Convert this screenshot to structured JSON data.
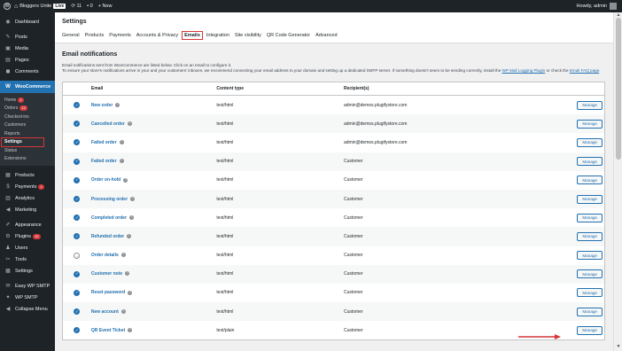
{
  "adminbar": {
    "site_name": "Bloggers Unite",
    "live_badge": "Live",
    "updates_count": "11",
    "comments_count": "0",
    "new_label": "New",
    "greeting": "Howdy, admin"
  },
  "sidebar": {
    "items_top": [
      {
        "icon": "dashboard-icon",
        "glyph": "◉",
        "label": "Dashboard"
      },
      {
        "icon": "pin-icon",
        "glyph": "✎",
        "label": "Posts"
      },
      {
        "icon": "media-icon",
        "glyph": "▣",
        "label": "Media"
      },
      {
        "icon": "pages-icon",
        "glyph": "▤",
        "label": "Pages"
      },
      {
        "icon": "comments-icon",
        "glyph": "◼",
        "label": "Comments"
      }
    ],
    "woocommerce": {
      "icon": "woocommerce-icon",
      "glyph": "W",
      "label": "WooCommerce"
    },
    "submenu": [
      {
        "label": "Home",
        "badge": "2"
      },
      {
        "label": "Orders",
        "badge": "13"
      },
      {
        "label": "Checked-ins",
        "badge": ""
      },
      {
        "label": "Customers",
        "badge": ""
      },
      {
        "label": "Reports",
        "badge": ""
      },
      {
        "label": "Settings",
        "badge": ""
      },
      {
        "label": "Status",
        "badge": ""
      },
      {
        "label": "Extensions",
        "badge": ""
      }
    ],
    "items_bottom": [
      {
        "icon": "products-icon",
        "glyph": "▦",
        "label": "Products",
        "badge": ""
      },
      {
        "icon": "payments-icon",
        "glyph": "$",
        "label": "Payments",
        "badge": "1"
      },
      {
        "icon": "analytics-icon",
        "glyph": "▥",
        "label": "Analytics",
        "badge": ""
      },
      {
        "icon": "marketing-icon",
        "glyph": "◀",
        "label": "Marketing",
        "badge": ""
      },
      {
        "icon": "appearance-icon",
        "glyph": "✐",
        "label": "Appearance",
        "badge": ""
      },
      {
        "icon": "plugins-icon",
        "glyph": "⚙",
        "label": "Plugins",
        "badge": "10"
      },
      {
        "icon": "users-icon",
        "glyph": "♟",
        "label": "Users",
        "badge": ""
      },
      {
        "icon": "tools-icon",
        "glyph": "✂",
        "label": "Tools",
        "badge": ""
      },
      {
        "icon": "settings-icon",
        "glyph": "▩",
        "label": "Settings",
        "badge": ""
      },
      {
        "icon": "easy-wp-smtp-icon",
        "glyph": "✉",
        "label": "Easy WP SMTP",
        "badge": ""
      },
      {
        "icon": "wp-smtp-icon",
        "glyph": "✦",
        "label": "WP SMTP",
        "badge": ""
      },
      {
        "icon": "collapse-menu-icon",
        "glyph": "◀",
        "label": "Collapse Menu",
        "badge": ""
      }
    ]
  },
  "header": {
    "title": "Settings",
    "tabs": [
      "General",
      "Products",
      "Payments",
      "Accounts & Privacy",
      "Emails",
      "Integration",
      "Site visibility",
      "QR Code Generator",
      "Advanced"
    ],
    "current_tab": 4
  },
  "main": {
    "section_title": "Email notifications",
    "desc_line1": "Email notifications sent from WooCommerce are listed below. Click on an email to configure it.",
    "desc_line2": "To ensure your store's notifications arrive in your and your customers' inboxes, we recommend connecting your email address to your domain and setting up a dedicated SMTP server. If something doesn't seem to be sending correctly, install the ",
    "desc_link1": "WP Mail Logging Plugin",
    "desc_mid": " or check the ",
    "desc_link2": "Email FAQ page",
    "desc_end": "."
  },
  "table": {
    "headers": {
      "email": "Email",
      "content_type": "Content type",
      "recipients": "Recipient(s)"
    },
    "manage_label": "Manage",
    "rows": [
      {
        "name": "New order",
        "type": "text/html",
        "recipient": "admin@demos.plugifystore.com",
        "enabled": true
      },
      {
        "name": "Cancelled order",
        "type": "text/html",
        "recipient": "admin@demos.plugifystore.com",
        "enabled": true
      },
      {
        "name": "Failed order",
        "type": "text/html",
        "recipient": "admin@demos.plugifystore.com",
        "enabled": true
      },
      {
        "name": "Failed order",
        "type": "text/html",
        "recipient": "Customer",
        "enabled": true
      },
      {
        "name": "Order on-hold",
        "type": "text/html",
        "recipient": "Customer",
        "enabled": true
      },
      {
        "name": "Processing order",
        "type": "text/html",
        "recipient": "Customer",
        "enabled": true
      },
      {
        "name": "Completed order",
        "type": "text/html",
        "recipient": "Customer",
        "enabled": true
      },
      {
        "name": "Refunded order",
        "type": "text/html",
        "recipient": "Customer",
        "enabled": true
      },
      {
        "name": "Order details",
        "type": "text/html",
        "recipient": "Customer",
        "enabled": false
      },
      {
        "name": "Customer note",
        "type": "text/html",
        "recipient": "Customer",
        "enabled": true
      },
      {
        "name": "Reset password",
        "type": "text/html",
        "recipient": "Customer",
        "enabled": true
      },
      {
        "name": "New account",
        "type": "text/html",
        "recipient": "Customer",
        "enabled": true
      },
      {
        "name": "QR Event Ticket",
        "type": "text/plain",
        "recipient": "Customer",
        "enabled": true
      }
    ]
  },
  "colors": {
    "accent": "#2271b1",
    "highlight": "#d63638",
    "sidebar": "#1d2327"
  }
}
